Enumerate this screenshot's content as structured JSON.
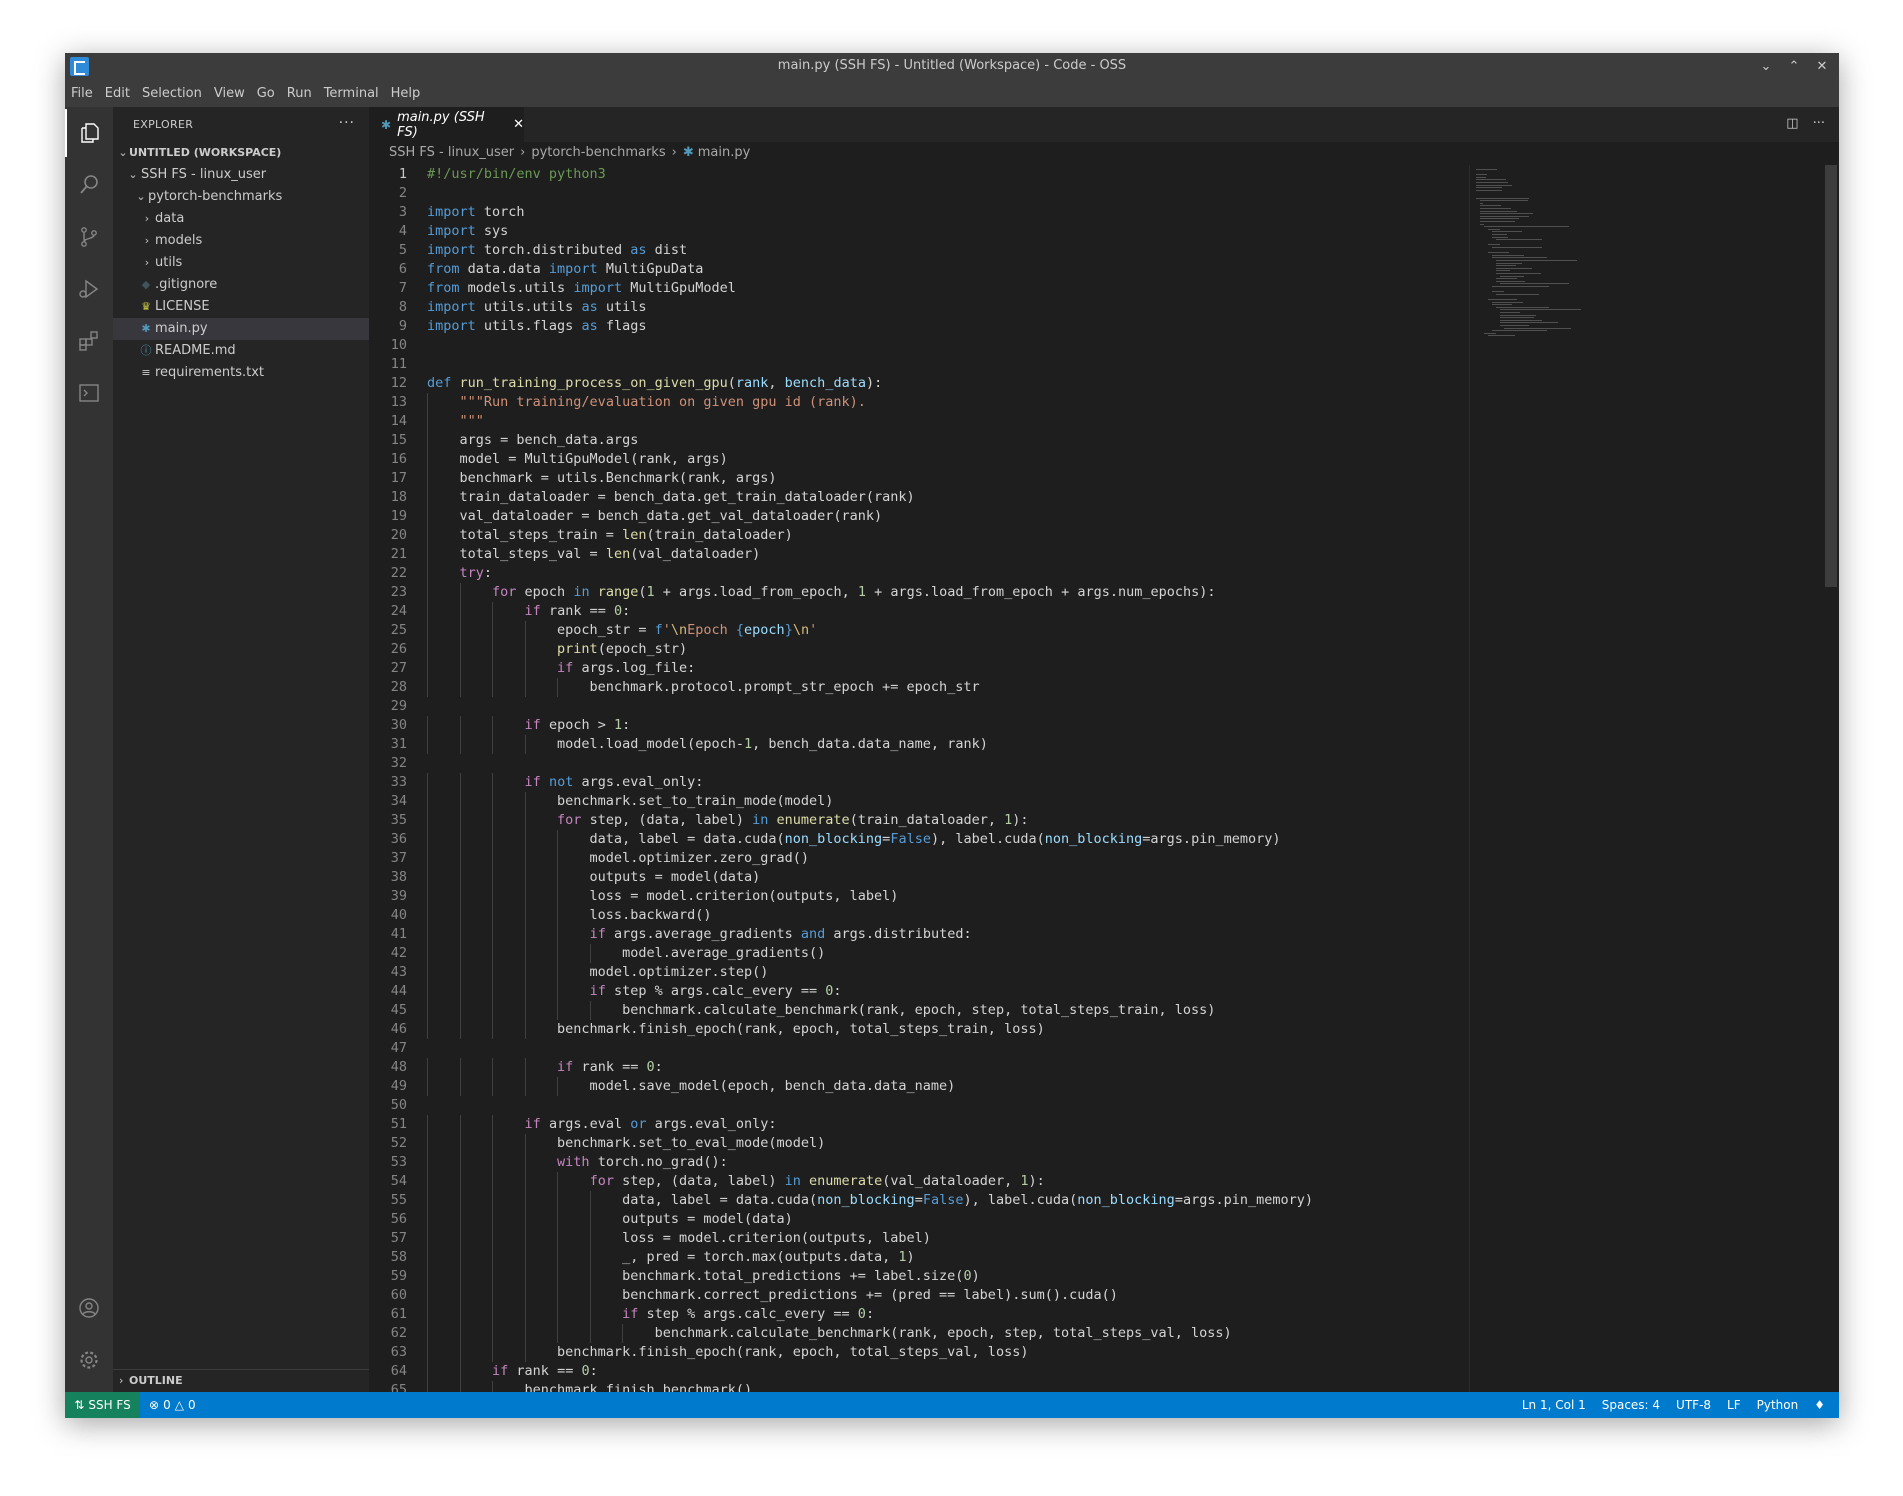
{
  "window": {
    "title": "main.py (SSH FS) - Untitled (Workspace) - Code - OSS"
  },
  "menu": [
    "File",
    "Edit",
    "Selection",
    "View",
    "Go",
    "Run",
    "Terminal",
    "Help"
  ],
  "sidebar": {
    "header": "EXPLORER",
    "workspace": "UNTITLED (WORKSPACE)",
    "remote_root": "SSH FS - linux_user",
    "project": "pytorch-benchmarks",
    "items": [
      {
        "label": "data",
        "type": "folder"
      },
      {
        "label": "models",
        "type": "folder"
      },
      {
        "label": "utils",
        "type": "folder"
      },
      {
        "label": ".gitignore",
        "type": "file",
        "icon": "gitignore-icon"
      },
      {
        "label": "LICENSE",
        "type": "file",
        "icon": "license-icon"
      },
      {
        "label": "main.py",
        "type": "file",
        "icon": "python-icon",
        "selected": true
      },
      {
        "label": "README.md",
        "type": "file",
        "icon": "info-icon"
      },
      {
        "label": "requirements.txt",
        "type": "file",
        "icon": "text-file-icon"
      }
    ],
    "outline": "OUTLINE"
  },
  "editor": {
    "tab_label": "main.py (SSH FS)",
    "breadcrumb": [
      "SSH FS - linux_user",
      "pytorch-benchmarks",
      "main.py"
    ],
    "current_line": 1,
    "lines": [
      "#!/usr/bin/env python3",
      "",
      "import torch",
      "import sys",
      "import torch.distributed as dist",
      "from data.data import MultiGpuData",
      "from models.utils import MultiGpuModel",
      "import utils.utils as utils",
      "import utils.flags as flags",
      "",
      "",
      "def run_training_process_on_given_gpu(rank, bench_data):",
      "    \"\"\"Run training/evaluation on given gpu id (rank).",
      "    \"\"\"",
      "    args = bench_data.args",
      "    model = MultiGpuModel(rank, args)",
      "    benchmark = utils.Benchmark(rank, args)",
      "    train_dataloader = bench_data.get_train_dataloader(rank)",
      "    val_dataloader = bench_data.get_val_dataloader(rank)",
      "    total_steps_train = len(train_dataloader)",
      "    total_steps_val = len(val_dataloader)",
      "    try:",
      "        for epoch in range(1 + args.load_from_epoch, 1 + args.load_from_epoch + args.num_epochs):",
      "            if rank == 0:",
      "                epoch_str = f'\\nEpoch {epoch}\\n'",
      "                print(epoch_str)",
      "                if args.log_file:",
      "                    benchmark.protocol.prompt_str_epoch += epoch_str",
      "",
      "            if epoch > 1:",
      "                model.load_model(epoch-1, bench_data.data_name, rank)",
      "",
      "            if not args.eval_only:",
      "                benchmark.set_to_train_mode(model)",
      "                for step, (data, label) in enumerate(train_dataloader, 1):",
      "                    data, label = data.cuda(non_blocking=False), label.cuda(non_blocking=args.pin_memory)",
      "                    model.optimizer.zero_grad()",
      "                    outputs = model(data)",
      "                    loss = model.criterion(outputs, label)",
      "                    loss.backward()",
      "                    if args.average_gradients and args.distributed:",
      "                        model.average_gradients()",
      "                    model.optimizer.step()",
      "                    if step % args.calc_every == 0:",
      "                        benchmark.calculate_benchmark(rank, epoch, step, total_steps_train, loss)",
      "                benchmark.finish_epoch(rank, epoch, total_steps_train, loss)",
      "",
      "                if rank == 0:",
      "                    model.save_model(epoch, bench_data.data_name)",
      "",
      "            if args.eval or args.eval_only:",
      "                benchmark.set_to_eval_mode(model)",
      "                with torch.no_grad():",
      "                    for step, (data, label) in enumerate(val_dataloader, 1):",
      "                        data, label = data.cuda(non_blocking=False), label.cuda(non_blocking=args.pin_memory)",
      "                        outputs = model(data)",
      "                        loss = model.criterion(outputs, label)",
      "                        _, pred = torch.max(outputs.data, 1)",
      "                        benchmark.total_predictions += label.size(0)",
      "                        benchmark.correct_predictions += (pred == label).sum().cuda()",
      "                        if step % args.calc_every == 0:",
      "                            benchmark.calculate_benchmark(rank, epoch, step, total_steps_val, loss)",
      "                benchmark.finish_epoch(rank, epoch, total_steps_val, loss)",
      "        if rank == 0:",
      "            benchmark.finish_benchmark()"
    ]
  },
  "statusbar": {
    "remote": "SSH FS",
    "errors": "0",
    "warnings": "0",
    "position": "Ln 1, Col 1",
    "spaces": "Spaces: 4",
    "encoding": "UTF-8",
    "eol": "LF",
    "language": "Python"
  },
  "colors": {
    "keyword": "#569cd6",
    "control": "#c586c0",
    "function": "#dcdcaa",
    "string": "#ce9178",
    "comment": "#6a9955",
    "number": "#b5cea8",
    "param": "#9cdcfe",
    "statusbar": "#007acc",
    "remote": "#16825d"
  }
}
